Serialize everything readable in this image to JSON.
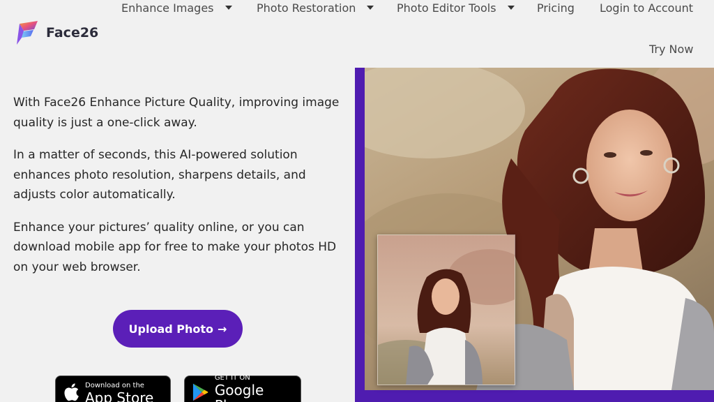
{
  "brand": {
    "name": "Face26"
  },
  "nav": {
    "items": [
      {
        "label": "Enhance Images",
        "dropdown": true
      },
      {
        "label": "Photo Restoration",
        "dropdown": true
      },
      {
        "label": "Photo Editor Tools",
        "dropdown": true
      },
      {
        "label": "Pricing",
        "dropdown": false
      },
      {
        "label": "Login to Account",
        "dropdown": false
      }
    ],
    "try_now": "Try Now"
  },
  "intro": {
    "p1": "With Face26 Enhance Picture Quality, improving image quality is just a one-click away.",
    "p2": "In a matter of seconds, this AI-powered solution enhances photo resolution, sharpens details, and adjusts color automatically.",
    "p3": "Enhance your pictures’ quality online, or you can download mobile app for free to make your photos HD on your web browser."
  },
  "cta": {
    "upload_label": "Upload Photo",
    "arrow": "→"
  },
  "stores": {
    "apple": {
      "small": "Download on the",
      "big": "App Store"
    },
    "google": {
      "small": "GET IT ON",
      "big": "Google Play"
    }
  },
  "colors": {
    "accent": "#5b1fb8",
    "frame": "#4f1cb0",
    "background": "#f1f1f1"
  }
}
